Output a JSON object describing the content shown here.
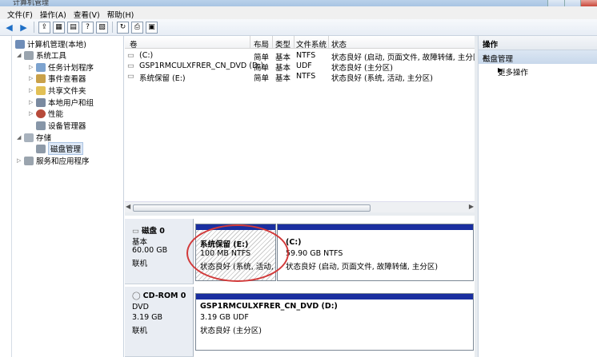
{
  "window": {
    "title": "计算机管理"
  },
  "menu": [
    "文件(F)",
    "操作(A)",
    "查看(V)",
    "帮助(H)"
  ],
  "tree": {
    "root": "计算机管理(本地)",
    "system_tools": "系统工具",
    "items": [
      "任务计划程序",
      "事件查看器",
      "共享文件夹",
      "本地用户和组",
      "性能",
      "设备管理器"
    ],
    "storage": "存储",
    "disk_mgmt": "磁盘管理",
    "services": "服务和应用程序"
  },
  "list": {
    "headers": [
      "卷",
      "布局",
      "类型",
      "文件系统",
      "状态"
    ],
    "rows": [
      {
        "vol": "(C:)",
        "layout": "简单",
        "type": "基本",
        "fs": "NTFS",
        "status": "状态良好 (启动, 页面文件, 故障转储, 主分区)"
      },
      {
        "vol": "GSP1RMCULXFRER_CN_DVD (D:)",
        "layout": "简单",
        "type": "基本",
        "fs": "UDF",
        "status": "状态良好 (主分区)"
      },
      {
        "vol": "系统保留 (E:)",
        "layout": "简单",
        "type": "基本",
        "fs": "NTFS",
        "status": "状态良好 (系统, 活动, 主分区)"
      }
    ]
  },
  "disk0": {
    "name": "磁盘 0",
    "kind": "基本",
    "size": "60.00 GB",
    "state": "联机",
    "p1": {
      "name": "系统保留  (E:)",
      "size": "100 MB NTFS",
      "status": "状态良好 (系统, 活动, 主"
    },
    "p2": {
      "name": "(C:)",
      "size": "59.90 GB NTFS",
      "status": "状态良好 (启动, 页面文件, 故障转储, 主分区)"
    }
  },
  "cdrom0": {
    "name": "CD-ROM 0",
    "kind": "DVD",
    "size": "3.19 GB",
    "state": "联机",
    "p1": {
      "name": "GSP1RMCULXFRER_CN_DVD  (D:)",
      "size": "3.19 GB UDF",
      "status": "状态良好 (主分区)"
    }
  },
  "actions": {
    "header": "操作",
    "section": "磁盘管理",
    "more": "更多操作"
  }
}
